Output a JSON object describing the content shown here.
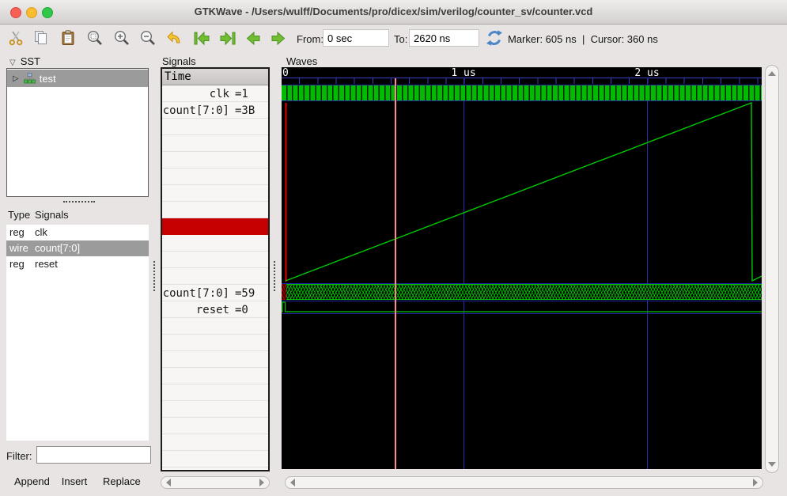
{
  "window": {
    "title": "GTKWave - /Users/wulff/Documents/pro/dicex/sim/verilog/counter_sv/counter.vcd"
  },
  "toolbar": {
    "from_label": "From:",
    "from_value": "0 sec",
    "to_label": "To:",
    "to_value": "2620 ns",
    "marker_label": "Marker: 605 ns",
    "separator": "|",
    "cursor_label": "Cursor: 360 ns",
    "icons": [
      "cut",
      "copy",
      "paste",
      "zoom-fit",
      "zoom-in",
      "zoom-out",
      "undo",
      "prev-edge",
      "next-edge",
      "shift-left",
      "shift-right",
      "reload"
    ]
  },
  "sst": {
    "header": "SST",
    "tree": [
      {
        "label": "test",
        "selected": true
      }
    ],
    "list_headers": {
      "type": "Type",
      "signals": "Signals"
    },
    "signal_rows": [
      {
        "type": "reg",
        "name": "clk",
        "selected": false
      },
      {
        "type": "wire",
        "name": "count[7:0]",
        "selected": true
      },
      {
        "type": "reg",
        "name": "reset",
        "selected": false
      }
    ],
    "filter_label": "Filter:",
    "filter_value": "",
    "buttons": {
      "append": "Append",
      "insert": "Insert",
      "replace": "Replace"
    }
  },
  "signals_panel": {
    "label": "Signals",
    "time_header": "Time",
    "upper_rows": [
      {
        "name": "clk",
        "value": "=1"
      },
      {
        "name": "count[7:0]",
        "value": "=3B"
      }
    ],
    "lower_rows": [
      {
        "name": "count[7:0]",
        "value": "=59"
      },
      {
        "name": "reset",
        "value": "=0"
      }
    ]
  },
  "waves": {
    "label": "Waves",
    "timeline_labels": [
      {
        "text": "0"
      },
      {
        "text": "1 us"
      },
      {
        "text": "2 us"
      }
    ],
    "traces": [
      "clk clock wave",
      "count[7:0] analog ramp 0..FF wrap at ~2560 ns",
      "count[7:0] bus",
      "reset pulse at t=0"
    ]
  },
  "colors": {
    "wave_green": "#00c800",
    "wave_undefined_red": "#d40000",
    "grid_blue": "#2a2aa8",
    "marker_line": "#ff8a86",
    "selection_red": "#c60000",
    "selection_gray": "#9b9b9b",
    "canvas_black": "#000000"
  }
}
